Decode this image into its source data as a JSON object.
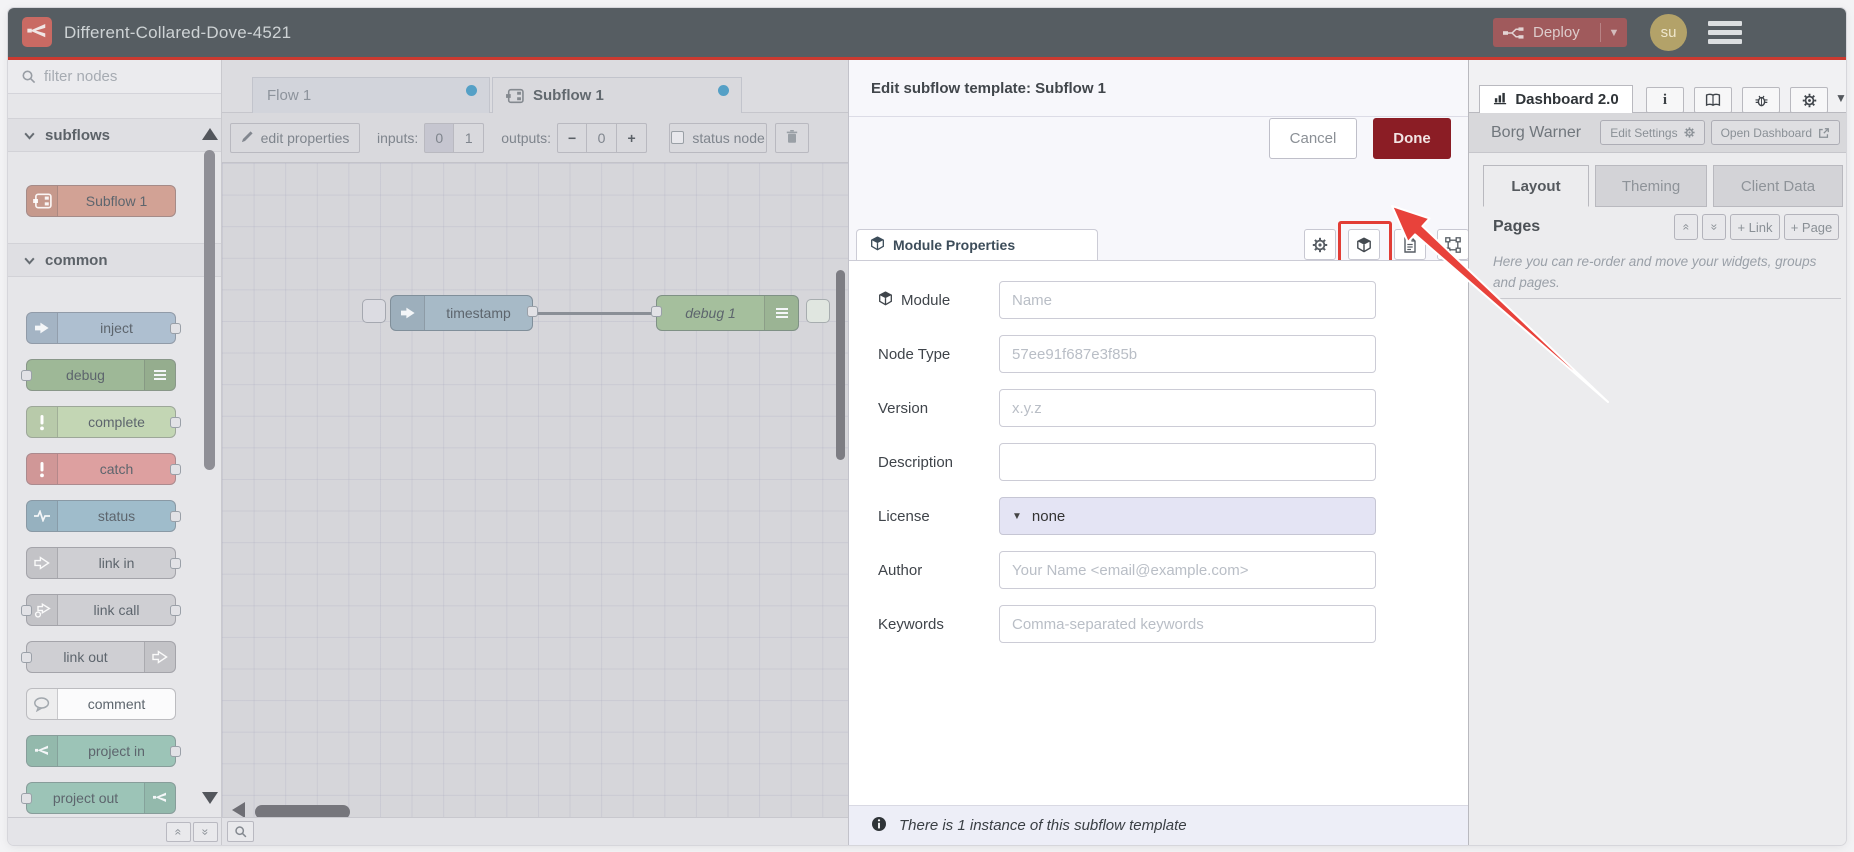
{
  "header": {
    "title": "Different-Collared-Dove-4521",
    "deploy_label": "Deploy",
    "avatar_initials": "su"
  },
  "palette": {
    "filter_placeholder": "filter nodes",
    "sections": [
      {
        "label": "subflows",
        "items": [
          {
            "label": "Subflow 1",
            "icon": "subflow",
            "icon_side": "left",
            "color": "#d2a295",
            "port_left": false,
            "port_right": false
          }
        ]
      },
      {
        "label": "common",
        "items": [
          {
            "label": "inject",
            "icon": "inject",
            "icon_side": "left",
            "color": "#aebfd0",
            "port_left": false,
            "port_right": true
          },
          {
            "label": "debug",
            "icon": "debug",
            "icon_side": "right",
            "color": "#9eb897",
            "port_left": true,
            "port_right": false
          },
          {
            "label": "complete",
            "icon": "bang",
            "icon_side": "left",
            "color": "#c3d6b4",
            "port_left": false,
            "port_right": true
          },
          {
            "label": "catch",
            "icon": "bang",
            "icon_side": "left",
            "color": "#dda0a0",
            "port_left": false,
            "port_right": true
          },
          {
            "label": "status",
            "icon": "status",
            "icon_side": "left",
            "color": "#9fbccb",
            "port_left": false,
            "port_right": true
          },
          {
            "label": "link in",
            "icon": "linkin",
            "icon_side": "left",
            "color": "#cfcfd3",
            "port_left": false,
            "port_right": true
          },
          {
            "label": "link call",
            "icon": "linkcall",
            "icon_side": "left",
            "color": "#cfcfd3",
            "port_left": true,
            "port_right": true
          },
          {
            "label": "link out",
            "icon": "linkout",
            "icon_side": "right",
            "color": "#cfcfd3",
            "port_left": true,
            "port_right": false
          },
          {
            "label": "comment",
            "icon": "comment",
            "icon_side": "left",
            "color": "#fbfbfc",
            "port_left": false,
            "port_right": false
          },
          {
            "label": "project in",
            "icon": "nr",
            "icon_side": "left",
            "color": "#9cc4b7",
            "port_left": false,
            "port_right": true
          },
          {
            "label": "project out",
            "icon": "nr",
            "icon_side": "right",
            "color": "#9cc4b7",
            "port_left": true,
            "port_right": false
          }
        ]
      }
    ]
  },
  "workspace": {
    "tabs": [
      {
        "label": "Flow 1",
        "active": false
      },
      {
        "label": "Subflow 1",
        "active": true
      }
    ],
    "toolbar": {
      "edit_properties": "edit properties",
      "inputs_label": "inputs:",
      "inputs_options": [
        "0",
        "1"
      ],
      "inputs_selected": "0",
      "outputs_label": "outputs:",
      "outputs_minus": "−",
      "outputs_value": "0",
      "outputs_plus": "+",
      "status_node_label": "status node"
    },
    "nodes": [
      {
        "label": "timestamp",
        "icon": "inject",
        "icon_side": "left",
        "color": "#a7bac7",
        "italic": false
      },
      {
        "label": "debug 1",
        "icon": "debug",
        "icon_side": "right",
        "color": "#a5bf9d",
        "italic": true
      }
    ]
  },
  "panel": {
    "title": "Edit subflow template: Subflow 1",
    "cancel_label": "Cancel",
    "done_label": "Done",
    "tab_label": "Module Properties",
    "fields": [
      {
        "label": "Module",
        "kind": "input",
        "icon": "cube",
        "placeholder": "Name",
        "value": ""
      },
      {
        "label": "Node Type",
        "kind": "input",
        "placeholder": "57ee91f687e3f85b",
        "value": ""
      },
      {
        "label": "Version",
        "kind": "input",
        "placeholder": "x.y.z",
        "value": ""
      },
      {
        "label": "Description",
        "kind": "input",
        "placeholder": "",
        "value": ""
      },
      {
        "label": "License",
        "kind": "select",
        "value": "none"
      },
      {
        "label": "Author",
        "kind": "input",
        "placeholder": "Your Name <email@example.com>",
        "value": ""
      },
      {
        "label": "Keywords",
        "kind": "input",
        "placeholder": "Comma-separated keywords",
        "value": ""
      }
    ],
    "footer_text": "There is 1 instance of this subflow template"
  },
  "sidebar": {
    "tab_label": "Dashboard 2.0",
    "section_title": "Borg Warner",
    "edit_settings_label": "Edit Settings",
    "open_dashboard_label": "Open Dashboard",
    "tabs": [
      "Layout",
      "Theming",
      "Client Data"
    ],
    "active_tab": "Layout",
    "pages_title": "Pages",
    "link_button": "+ Link",
    "page_button": "+ Page",
    "help_text": "Here you can re-order and move your widgets, groups and pages."
  },
  "colors": {
    "accent_red": "#e23d35",
    "header_redline": "#cb3a30",
    "done_button": "#8b1d25",
    "deploy_button": "#a05a5c",
    "tab_dot": "#55a0c6"
  }
}
